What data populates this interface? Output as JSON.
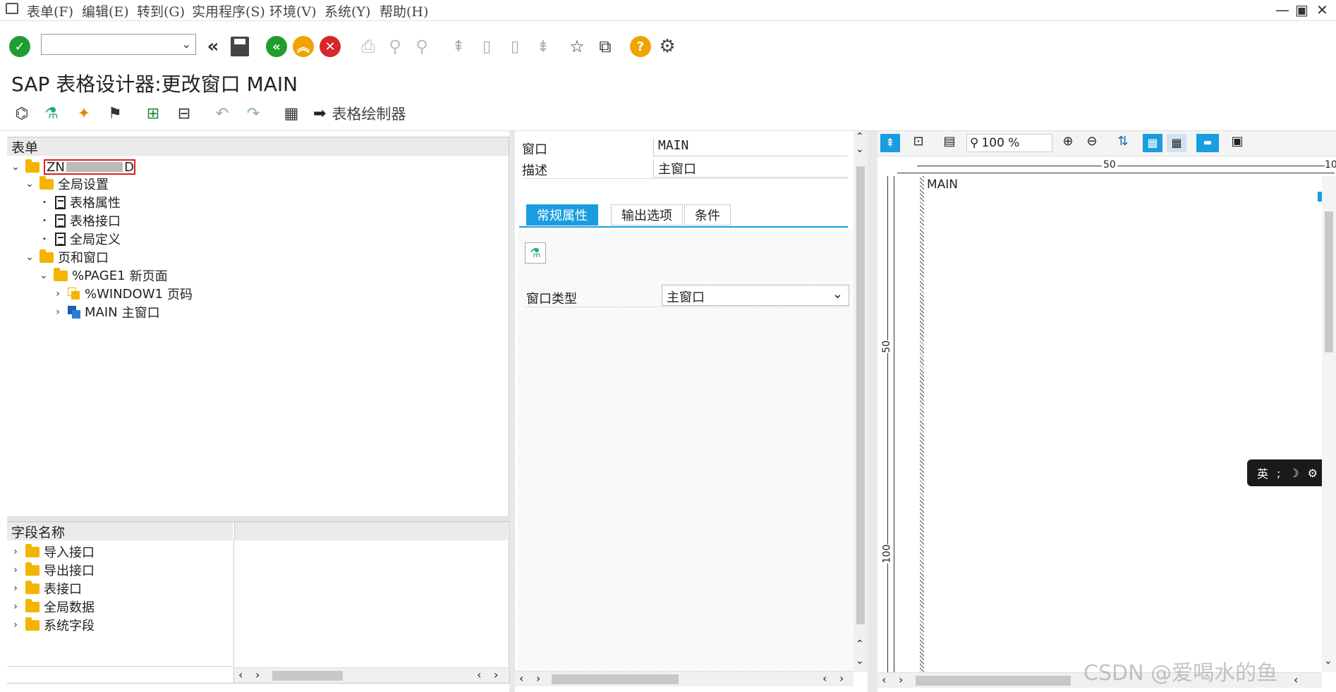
{
  "menubar": {
    "items": [
      "表单(F)",
      "编辑(E)",
      "转到(G)",
      "实用程序(S)",
      "环境(V)",
      "系统(Y)",
      "帮助(H)"
    ]
  },
  "titlebar": {
    "title": "SAP 表格设计器:更改窗口 MAIN"
  },
  "apptoolbar": {
    "form_painter_label": "表格绘制器"
  },
  "tree": {
    "header": "表单",
    "root_label": "ZN",
    "root_label_tail": "D",
    "global_settings": "全局设置",
    "form_attributes": "表格属性",
    "form_interface": "表格接口",
    "global_definitions": "全局定义",
    "pages_windows": "页和窗口",
    "page1_name": "%PAGE1",
    "page1_desc": "新页面",
    "window1_name": "%WINDOW1",
    "window1_desc": "页码",
    "main_name": "MAIN",
    "main_desc": "主窗口"
  },
  "fieldlist": {
    "header": "字段名称",
    "items": [
      "导入接口",
      "导出接口",
      "表接口",
      "全局数据",
      "系统字段"
    ]
  },
  "properties": {
    "window_label": "窗口",
    "window_value": "MAIN",
    "desc_label": "描述",
    "desc_value": "主窗口",
    "tabs": [
      "常规属性",
      "输出选项",
      "条件"
    ],
    "window_type_label": "窗口类型",
    "window_type_value": "主窗口"
  },
  "painter": {
    "zoom": "100 %",
    "ruler_h": [
      "50",
      "10"
    ],
    "ruler_v": [
      "50",
      "100"
    ],
    "window_label": "MAIN"
  },
  "ime": {
    "label": "英"
  },
  "watermark": "CSDN @爱喝水的鱼",
  "colors": {
    "accent": "#1a9de0",
    "ok": "#1f9d2f",
    "cancel": "#d9262a",
    "orange": "#f0a400"
  }
}
